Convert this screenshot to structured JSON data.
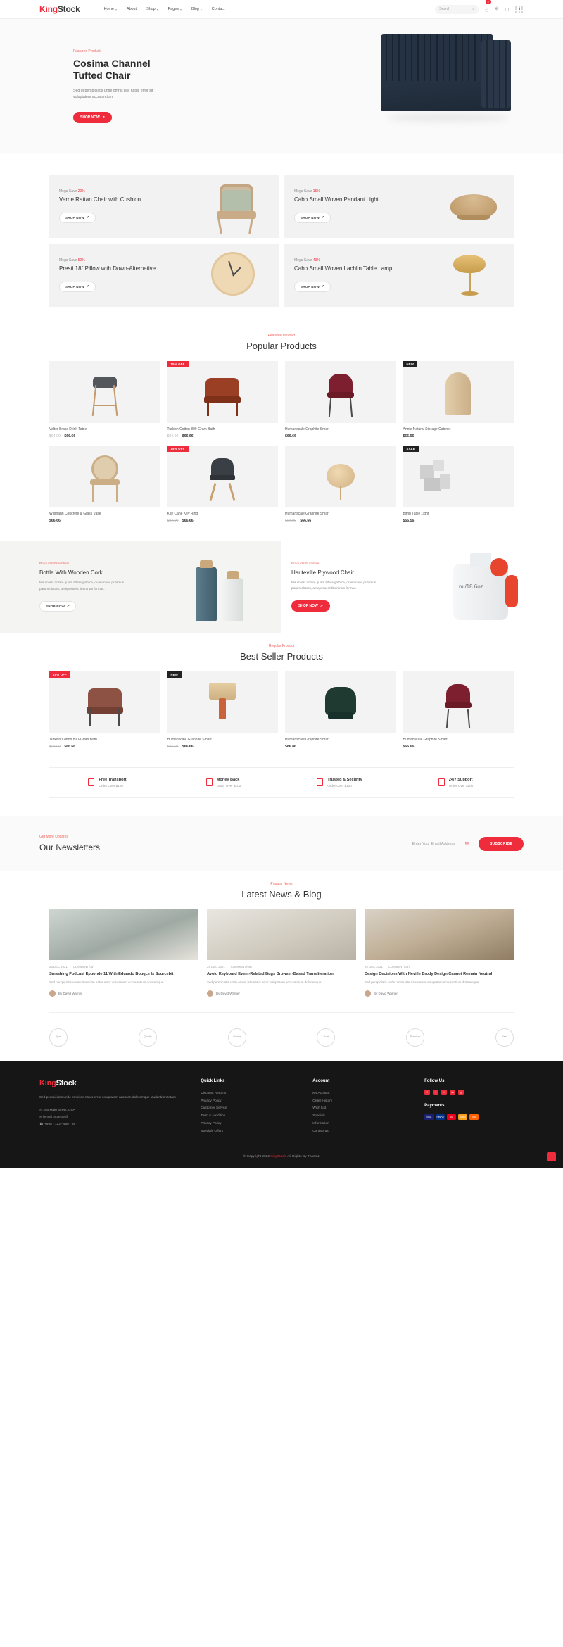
{
  "brand": {
    "first": "King",
    "second": "Stock"
  },
  "header": {
    "nav": [
      {
        "label": "Home",
        "caret": "▾"
      },
      {
        "label": "About",
        "caret": ""
      },
      {
        "label": "Shop",
        "caret": "▾"
      },
      {
        "label": "Pages",
        "caret": "▾"
      },
      {
        "label": "Blog",
        "caret": "▾"
      },
      {
        "label": "Contact",
        "caret": ""
      }
    ],
    "search_placeholder": "Search",
    "search_icon": "⌕",
    "cart_badge": "2",
    "icons": [
      "heart-icon",
      "user-icon",
      "cart-icon"
    ]
  },
  "hero": {
    "eyebrow": "Featured Product",
    "title_line1": "Cosima Channel",
    "title_line2": "Tufted Chair",
    "desc": "Sed ut perspiciatis unde omnis iste natus error sit voluptatem accusantium",
    "cta": "SHOP NOW"
  },
  "promos": [
    {
      "mega_prefix": "Mega Save",
      "mega_pct": "20%",
      "title": "Verne Rattan Chair with Cushion",
      "cta": "SHOP NOW"
    },
    {
      "mega_prefix": "Mega Save",
      "mega_pct": "15%",
      "title": "Cabo Small Woven Pendant Light",
      "cta": "SHOP NOW"
    },
    {
      "mega_prefix": "Mega Save",
      "mega_pct": "50%",
      "title": "Presti 18\" Pillow with Down-Alternative",
      "cta": "SHOP NOW"
    },
    {
      "mega_prefix": "Mega Save",
      "mega_pct": "43%",
      "title": "Cabo Small Woven Lachlin Table Lamp",
      "cta": "SHOP NOW"
    }
  ],
  "popular": {
    "eyebrow": "Featured Product",
    "title": "Popular Products",
    "items": [
      {
        "name": "Valter Brass Drink Table",
        "old": "$94.00",
        "now": "$66.66",
        "tag": ""
      },
      {
        "name": "Turkish Cotton 800-Gram Bath",
        "old": "$94.00",
        "now": "$66.66",
        "tag": "15% OFF"
      },
      {
        "name": "Humanscale Graphite Smart",
        "old": "",
        "now": "$66.66",
        "tag": ""
      },
      {
        "name": "Annie Natural Storage Cabinet",
        "old": "",
        "now": "$66.66",
        "tag": "NEW"
      },
      {
        "name": "Willmann Concrete & Glass Vase",
        "old": "",
        "now": "$66.66",
        "tag": ""
      },
      {
        "name": "Kay Cane Key Ring",
        "old": "$94.00",
        "now": "$66.66",
        "tag": "15% OFF"
      },
      {
        "name": "Humanscale Graphite Smart",
        "old": "$94.00",
        "now": "$66.66",
        "tag": ""
      },
      {
        "name": "Bitrip Table Light",
        "old": "",
        "now": "$56.56",
        "tag": "SALE"
      }
    ]
  },
  "banners": [
    {
      "eyebrow": "Products Essentials",
      "title": "Bottle With Wooden Cork",
      "desc": "Mirum est notare quam littera gothica, quam nunc putamus parum clatam, anteposuerit litterarum formas.",
      "cta": "SHOP NOW"
    },
    {
      "eyebrow": "Products Furniture",
      "title": "Hauteville Plywood Chair",
      "desc": "Mirum est notare quam littera gothica, quam nunc putamus parum clatam, anteposuerit litterarum formas.",
      "cta": "SHOP NOW",
      "bottle_label": "ml/18.6oz"
    }
  ],
  "bestseller": {
    "eyebrow": "Regular Product",
    "title": "Best Seller Products",
    "items": [
      {
        "name": "Turkish Cotton 800-Gram Bath",
        "old": "$94.00",
        "now": "$66.66",
        "tag": "15% OFF"
      },
      {
        "name": "Humanscale Graphite Smart",
        "old": "$94.00",
        "now": "$66.66",
        "tag": "NEW"
      },
      {
        "name": "Humanscale Graphite Smart",
        "old": "",
        "now": "$86.86",
        "tag": ""
      },
      {
        "name": "Humanscale Graphite Smart",
        "old": "",
        "now": "$66.66",
        "tag": ""
      }
    ]
  },
  "features": [
    {
      "icon": "truck-icon",
      "title": "Free Transport",
      "sub": "Order Over $100"
    },
    {
      "icon": "money-icon",
      "title": "Money Back",
      "sub": "Order Over $100"
    },
    {
      "icon": "shield-icon",
      "title": "Trusted & Security",
      "sub": "Order Over $100"
    },
    {
      "icon": "headset-icon",
      "title": "24/7 Support",
      "sub": "Order Over $100"
    }
  ],
  "newsletter": {
    "eyebrow": "Get More Updates",
    "title": "Our Newsletters",
    "placeholder": "Enter Your Email Address",
    "mail_icon": "✉",
    "cta": "SUBSCRIBE"
  },
  "blog": {
    "eyebrow": "Popular News",
    "title": "Latest News & Blog",
    "posts": [
      {
        "date": "25 DEC 2021",
        "comments": "COMMENT(05)",
        "title": "Smashing Podcast Epuonde 11 With Eduardo Bouqce Is Sourcebit",
        "excerpt": "Sed perspiciatis unde omnis iste natus error voluptatem accusantium doloremque",
        "author": "By David Warner"
      },
      {
        "date": "25 DEC 2021",
        "comments": "COMMENT(05)",
        "title": "Avoid Keyboard Event-Related Bugs Browser-Based Transliteration",
        "excerpt": "Sed perspiciatis unde omnis iste natus error voluptatem accusantium doloremque",
        "author": "By David Warner"
      },
      {
        "date": "25 DEC 2021",
        "comments": "COMMENT(05)",
        "title": "Design Decisions With Neville Brody Design Cannot Remain Neutral",
        "excerpt": "Sed perspiciatis unde omnis iste natus error voluptatem accusantium doloremque",
        "author": "By David Warner"
      }
    ]
  },
  "brands": [
    "Sport",
    "Quality",
    "Choice",
    "Trust",
    "Premium",
    "Best"
  ],
  "footer": {
    "desc": "Sed perspiciatis unde omnisse natus error voluptatem accusan doloremque laudantium totam",
    "address": "250 Main Street, USA",
    "email": "[email protected]",
    "phone": "+898 - 123 - 456 - 98",
    "quick_links_title": "Quick Links",
    "quick_links": [
      "Discount Returns",
      "Privacy Policy",
      "Customer Service",
      "Term & condition",
      "Privacy Policy",
      "Specials Offers"
    ],
    "account_title": "Account",
    "account_links": [
      "My Account",
      "Order History",
      "Wish List",
      "Specials",
      "Information",
      "Contact us"
    ],
    "follow_title": "Follow Us",
    "socials": [
      {
        "name": "facebook-icon",
        "glyph": "f",
        "color": "#ee2c3c"
      },
      {
        "name": "twitter-icon",
        "glyph": "t",
        "color": "#ee2c3c"
      },
      {
        "name": "instagram-icon",
        "glyph": "i",
        "color": "#ee2c3c"
      },
      {
        "name": "linkedin-icon",
        "glyph": "in",
        "color": "#ee2c3c"
      },
      {
        "name": "youtube-icon",
        "glyph": "y",
        "color": "#ee2c3c"
      }
    ],
    "payments_title": "Payments",
    "payments": [
      {
        "name": "visa",
        "label": "VISA",
        "color": "#1a1f71"
      },
      {
        "name": "paypal",
        "label": "PayPal",
        "color": "#003087"
      },
      {
        "name": "mastercard",
        "label": "MC",
        "color": "#eb001b"
      },
      {
        "name": "amex",
        "label": "AMEX",
        "color": "#f79e1b"
      },
      {
        "name": "discover",
        "label": "DISC",
        "color": "#ff6000"
      }
    ],
    "copyright_pre": "© Copyright 2022 ",
    "copyright_brand": "KingStock",
    "copyright_post": ". All Rights By Thasrat."
  }
}
